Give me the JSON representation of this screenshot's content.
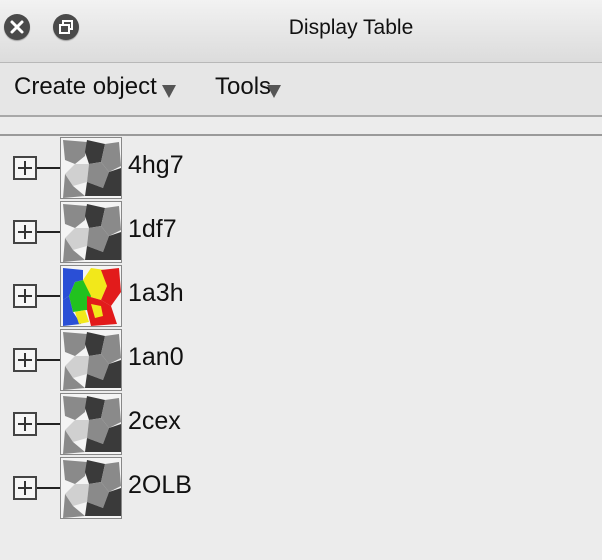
{
  "window": {
    "title": "Display Table",
    "close_icon": "close-icon",
    "restore_icon": "restore-window-icon"
  },
  "menubar": {
    "create_object": "Create object",
    "tools": "Tools"
  },
  "molecules": [
    {
      "name": "4hg7",
      "thumbnail": "molecule-thumbnail-gray",
      "color_style": "gray"
    },
    {
      "name": "1df7",
      "thumbnail": "molecule-thumbnail-gray",
      "color_style": "gray"
    },
    {
      "name": "1a3h",
      "thumbnail": "molecule-thumbnail-colored",
      "color_style": "colored"
    },
    {
      "name": "1an0",
      "thumbnail": "molecule-thumbnail-gray",
      "color_style": "gray"
    },
    {
      "name": "2cex",
      "thumbnail": "molecule-thumbnail-gray",
      "color_style": "gray"
    },
    {
      "name": "2OLB",
      "thumbnail": "molecule-thumbnail-gray",
      "color_style": "gray"
    }
  ],
  "colors": {
    "background": "#ececec",
    "thumb_dark": "#3a3a3a",
    "thumb_mid": "#8a8a8a",
    "thumb_light": "#d0d0d0",
    "color_red": "#e21b1b",
    "color_green": "#22c21f",
    "color_yellow": "#f2e81a",
    "color_blue": "#2a4fd6"
  }
}
